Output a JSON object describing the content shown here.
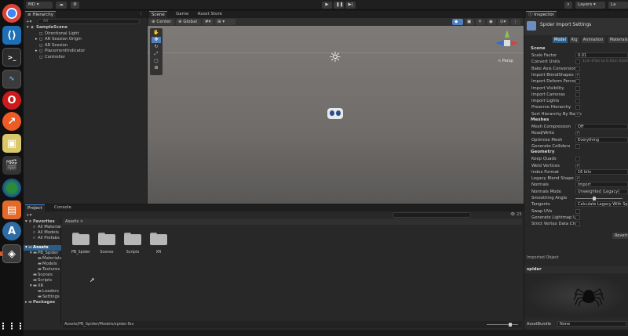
{
  "toolbar": {
    "account": "MD",
    "cloud_icon": "cloud-icon",
    "settings_icon": "gear-icon",
    "play": "▶",
    "pause": "❚❚",
    "step": "▶|",
    "layers": "Layers",
    "layout": "La"
  },
  "hierarchy": {
    "tab": "Hierarchy",
    "add": "+▾",
    "search_placeholder": "All",
    "items": [
      {
        "label": "SampleScene",
        "indent": 0,
        "arrow": "▾"
      },
      {
        "label": "Directional Light",
        "indent": 1,
        "arrow": ""
      },
      {
        "label": "AR Session Origin",
        "indent": 1,
        "arrow": "▸"
      },
      {
        "label": "AR Session",
        "indent": 1,
        "arrow": ""
      },
      {
        "label": "PlacementIndicator",
        "indent": 1,
        "arrow": "▸"
      },
      {
        "label": "Controller",
        "indent": 1,
        "arrow": ""
      }
    ]
  },
  "scene_tabs": [
    {
      "label": "Scene",
      "active": true
    },
    {
      "label": "Game",
      "active": false
    },
    {
      "label": "Asset Store",
      "active": false
    }
  ],
  "scene_toolbar": {
    "pivot": "Center",
    "space": "Global",
    "persp_label": "< Persp"
  },
  "inspector": {
    "tab": "Inspector",
    "title": "Spider Import Settings",
    "tabs": [
      "Model",
      "Rig",
      "Animation",
      "Materials"
    ],
    "scene_header": "Scene",
    "rows": [
      {
        "label": "Scale Factor",
        "value": "0.01",
        "kind": "field"
      },
      {
        "label": "Convert Units",
        "value": "1cm (File) to 0.01m (Unity)",
        "kind": "check"
      },
      {
        "label": "Bake Axis Conversion",
        "value": "",
        "kind": "check"
      },
      {
        "label": "Import BlendShapes",
        "value": "✓",
        "kind": "check"
      },
      {
        "label": "Import Deform Percent",
        "value": "",
        "kind": "check"
      },
      {
        "label": "Import Visibility",
        "value": "",
        "kind": "check"
      },
      {
        "label": "Import Cameras",
        "value": "",
        "kind": "check"
      },
      {
        "label": "Import Lights",
        "value": "",
        "kind": "check"
      },
      {
        "label": "Preserve Hierarchy",
        "value": "",
        "kind": "check"
      },
      {
        "label": "Sort Hierarchy By Name",
        "value": "✓",
        "kind": "check"
      }
    ],
    "meshes_header": "Meshes",
    "mesh_rows": [
      {
        "label": "Mesh Compression",
        "value": "Off",
        "kind": "field"
      },
      {
        "label": "Read/Write",
        "value": "✓",
        "kind": "check"
      },
      {
        "label": "Optimize Mesh",
        "value": "Everything",
        "kind": "field"
      },
      {
        "label": "Generate Colliders",
        "value": "",
        "kind": "check"
      }
    ],
    "geometry_header": "Geometry",
    "geo_rows": [
      {
        "label": "Keep Quads",
        "value": "",
        "kind": "check"
      },
      {
        "label": "Weld Vertices",
        "value": "✓",
        "kind": "check"
      },
      {
        "label": "Index Format",
        "value": "16 bits",
        "kind": "field"
      },
      {
        "label": "Legacy Blend Shape N",
        "value": "✓",
        "kind": "check"
      },
      {
        "label": "Normals",
        "value": "Import",
        "kind": "field"
      },
      {
        "label": "Normals Mode",
        "value": "Unweighted (Legacy)",
        "kind": "field"
      },
      {
        "label": "Smoothing Angle",
        "value": "",
        "kind": "slider"
      },
      {
        "label": "Tangents",
        "value": "Calculate Legacy With Split",
        "kind": "field"
      },
      {
        "label": "Swap UVs",
        "value": "",
        "kind": "check"
      },
      {
        "label": "Generate Lightmap UV",
        "value": "",
        "kind": "check"
      },
      {
        "label": "Strict Vertex Data Chec",
        "value": "",
        "kind": "check"
      }
    ],
    "revert": "Revert",
    "imported_object": "Imported Object",
    "preview_name": "spider",
    "assetbundle_label": "AssetBundle",
    "assetbundle_value": "None"
  },
  "project": {
    "tabs": [
      {
        "label": "Project",
        "active": true
      },
      {
        "label": "Console",
        "active": false
      }
    ],
    "add": "+▾",
    "favorites": "Favorites",
    "fav_items": [
      "All Materials",
      "All Models",
      "All Prefabs"
    ],
    "assets_root": "Assets",
    "tree": [
      {
        "label": "PB_Spider",
        "indent": 1,
        "arrow": "▾"
      },
      {
        "label": "Materials",
        "indent": 2,
        "arrow": ""
      },
      {
        "label": "Models",
        "indent": 2,
        "arrow": ""
      },
      {
        "label": "Textures",
        "indent": 2,
        "arrow": ""
      },
      {
        "label": "Scenes",
        "indent": 1,
        "arrow": ""
      },
      {
        "label": "Scripts",
        "indent": 1,
        "arrow": ""
      },
      {
        "label": "XR",
        "indent": 1,
        "arrow": "▾"
      },
      {
        "label": "Loaders",
        "indent": 2,
        "arrow": ""
      },
      {
        "label": "Settings",
        "indent": 2,
        "arrow": ""
      }
    ],
    "packages": "Packages",
    "breadcrumb": "Assets",
    "folders": [
      "PB_Spider",
      "Scenes",
      "Scripts",
      "XR"
    ],
    "status_path": "Assets/PB_Spider/Models/spider.fbx",
    "hidden_count": "23"
  }
}
